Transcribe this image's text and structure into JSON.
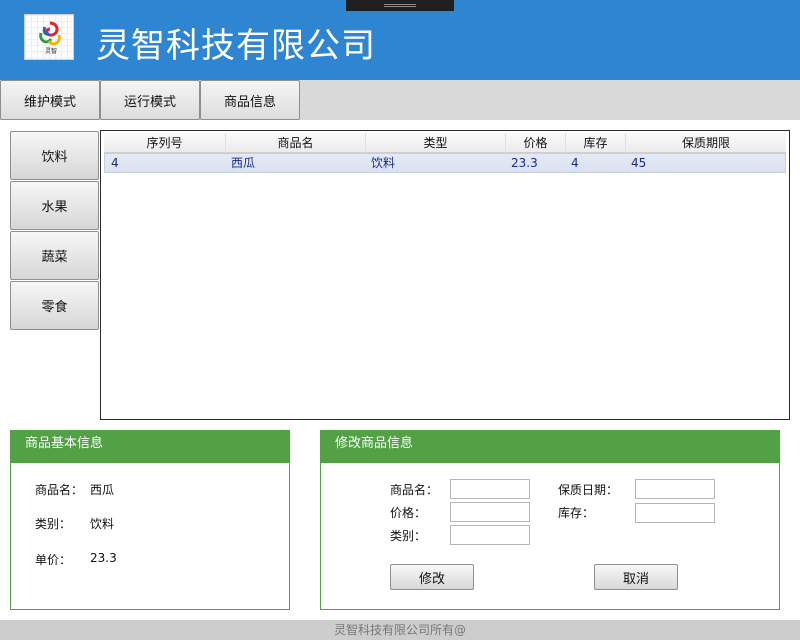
{
  "header": {
    "company": "灵智科技有限公司",
    "logo_text": "灵智"
  },
  "tabs": [
    {
      "label": "维护模式"
    },
    {
      "label": "运行模式"
    },
    {
      "label": "商品信息"
    }
  ],
  "categories": [
    {
      "label": "饮料"
    },
    {
      "label": "水果"
    },
    {
      "label": "蔬菜"
    },
    {
      "label": "零食"
    }
  ],
  "table": {
    "columns": [
      "序列号",
      "商品名",
      "类型",
      "价格",
      "库存",
      "保质期限"
    ],
    "rows": [
      [
        "4",
        "西瓜",
        "饮料",
        "23.3",
        "4",
        "45"
      ]
    ]
  },
  "basic_info": {
    "title": "商品基本信息",
    "name_label": "商品名：",
    "name_value": "西瓜",
    "type_label": "类别：",
    "type_value": "饮料",
    "price_label": "单价：",
    "price_value": "23.3"
  },
  "edit": {
    "title": "修改商品信息",
    "name_label": "商品名：",
    "price_label": "价格：",
    "type_label": "类别：",
    "shelf_label": "保质日期：",
    "stock_label": "库存：",
    "name_value": "",
    "price_value": "",
    "type_value": "",
    "shelf_value": "",
    "stock_value": "",
    "modify_button": "修改",
    "cancel_button": "取消"
  },
  "footer": {
    "text": "灵智科技有限公司所有@"
  },
  "colors": {
    "header": "#2e86d3",
    "panel": "#52a145"
  }
}
